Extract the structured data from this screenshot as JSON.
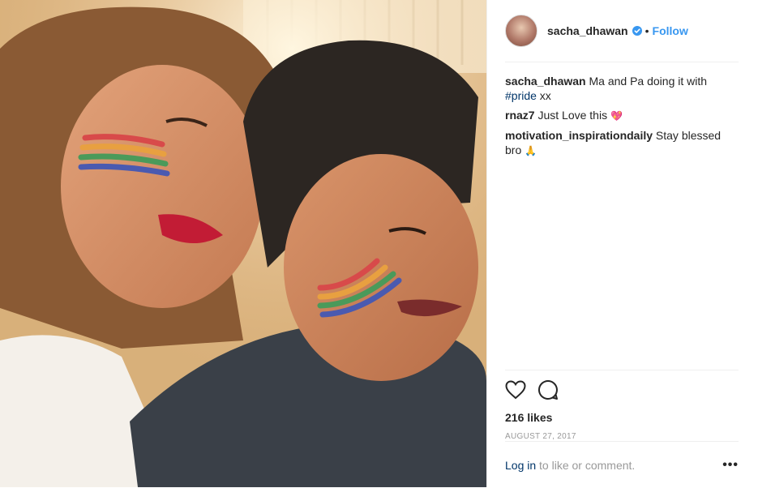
{
  "post": {
    "username": "sacha_dhawan",
    "follow_label": "Follow",
    "separator": "•",
    "caption": {
      "username": "sacha_dhawan",
      "text": "Ma and Pa doing it with ",
      "hashtag": "#pride",
      "suffix": " xx"
    },
    "comments": [
      {
        "username": "rnaz7",
        "text": " Just Love this ",
        "emoji": "💖"
      },
      {
        "username": "motivation_inspirationdaily",
        "text": " Stay blessed bro ",
        "emoji": "🙏"
      }
    ],
    "likes": "216 likes",
    "date": "AUGUST 27, 2017",
    "login_link": "Log in",
    "login_suffix": " to like or comment.",
    "more_label": "•••"
  },
  "colors": {
    "link": "#3897f0",
    "hashtag": "#003569",
    "muted": "#999999",
    "border": "#efefef"
  },
  "icons": [
    "verified-badge-icon",
    "heart-icon",
    "comment-icon",
    "more-options-icon"
  ]
}
